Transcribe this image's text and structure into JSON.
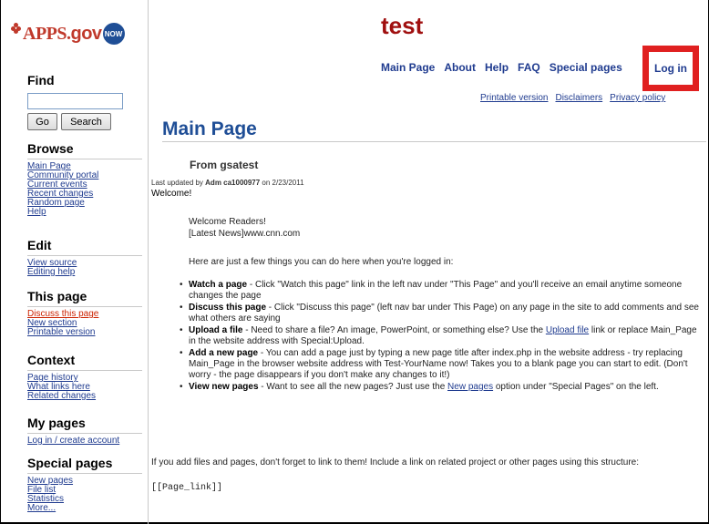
{
  "logo": {
    "apps": "APPS.",
    "gov": "gov",
    "now": "NOW"
  },
  "site_title": "test",
  "topnav": [
    "Main Page",
    "About",
    "Help",
    "FAQ",
    "Special pages"
  ],
  "login": "Log in",
  "subnav": [
    "Printable version",
    "Disclaimers",
    "Privacy policy"
  ],
  "sidebar": {
    "find": {
      "heading": "Find",
      "go": "Go",
      "search": "Search",
      "value": ""
    },
    "browse": {
      "heading": "Browse",
      "links": [
        "Main Page",
        "Community portal",
        "Current events",
        "Recent changes",
        "Random page",
        "Help"
      ]
    },
    "edit": {
      "heading": "Edit",
      "links": [
        "View source",
        "Editing help"
      ]
    },
    "this_page": {
      "heading": "This page",
      "links": [
        "Discuss this page",
        "New section",
        "Printable version"
      ]
    },
    "context": {
      "heading": "Context",
      "links": [
        "Page history",
        "What links here",
        "Related changes"
      ]
    },
    "my_pages": {
      "heading": "My pages",
      "links": [
        "Log in / create account"
      ]
    },
    "special": {
      "heading": "Special pages",
      "links": [
        "New pages",
        "File list",
        "Statistics",
        "More..."
      ]
    }
  },
  "content": {
    "title": "Main Page",
    "from": "From gsatest",
    "updated_prefix": "Last updated by ",
    "updated_user": "Adm ca1000977",
    "updated_suffix": " on 2/23/2011",
    "welcome": "Welcome!",
    "readers": "Welcome Readers!",
    "latest": "[Latest News]www.cnn.com",
    "intro": "Here are just a few things you can do here when you're logged in:",
    "bullets": [
      {
        "title": "Watch a page",
        "text": " - Click \"Watch this page\" link in the left nav under \"This Page\" and you'll receive an email anytime someone changes the page"
      },
      {
        "title": "Discuss this page",
        "text": " - Click \"Discuss this page\" (left nav bar under This Page) on any page in the site to add comments and see what others are saying"
      },
      {
        "title": "Upload a file",
        "text_a": " - Need to share a file? An image, PowerPoint, or something else? Use the ",
        "link": "Upload file",
        "text_b": " link or replace Main_Page in the website address with Special:Upload."
      },
      {
        "title": "Add a new page",
        "text": " - You can add a page just by typing a new page title after index.php in the website address - try replacing Main_Page in the browser website address with Test-YourName now! Takes you to a blank page you can start to edit. (Don't worry - the page disappears if you don't make any changes to it!)"
      },
      {
        "title": "View new pages",
        "text_a": " - Want to see all the new pages? Just use the ",
        "link": "New pages",
        "text_b": " option under \"Special Pages\" on the left."
      }
    ],
    "footer": "If you add files and pages, don't forget to link to them! Include a link on related project or other pages using this structure:",
    "code": "[[Page_link]]"
  }
}
